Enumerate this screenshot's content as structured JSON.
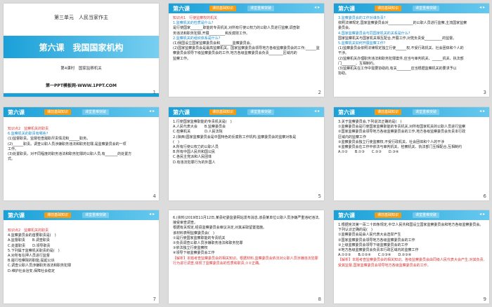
{
  "slides": [
    {
      "number": "1",
      "unit": "第三单元　人民当家作主",
      "title": "第六课　我国国家机构",
      "subtitle": "第4课时　国家监察机关",
      "site": "第一PPT模板网-WWW.1PPT.COM"
    },
    {
      "number": "2",
      "header": "第六课",
      "tab1": "课前基础知识",
      "tab2": "课堂重难突破",
      "lines": [
        "知识点1　行使监察权的机关",
        "1.监察机关的性质是什么?",
        "是行使国家_______职能的专责机关,对所有行使公权力的公职人员进行监察,调查职",
        "务违法和职务犯罪,开展_________和反腐败工作。",
        "2.监察机关的组织体系是什么?",
        "(1)我国设立国家监察委员会和_______监察委员会。",
        "(2)国家监察委员会是最高监察机关。国家监察委员会领导地方各级监察委员会的工作;______监",
        "察委员会领导下级监察委员会的工作,地方各级监察委员会负责________区域内的",
        "监察工作。"
      ]
    },
    {
      "number": "3",
      "lines": [
        "3.监察委员会的工作对谁负责?",
        "依照法律规定,国家监察委员会对______________的公职人员进行监察,主流国家监察",
        "委员会。",
        "4.国家监察委员会与同国家机关的关系是什么?",
        "国家监察机关与国家机关相互配合,开展工作,对党负责受__________的监督。",
        "5.监察机关如何开展监察工作?",
        "(1)监察委员会依照法律规定独立行使______权,不受行政机关、社会团体和个人的",
        "干涉。",
        "(2)监察机关办理职务违法和职务犯罪案件,应当与审判机关、______机关、执法部",
        "门________、互相制约。",
        "(3)监察机关在工作中需要协助的,有关________应当根据监察机关的要求予以",
        "协助。"
      ]
    },
    {
      "number": "4",
      "lines": [
        "知识点2　监察机关的职责",
        "6.监察机关的职责有哪些?",
        "(1)监督职责。监督检查履职尽责情况和______职务。",
        "(2)______职责。调查公职人员涉嫌职务违法和职务犯罪,是监察委员会的一项",
        "工作。",
        "(3)处置职责。对不同程度的职务违法和职务犯罪的公职人员,有_______的处置方",
        "式。"
      ]
    },
    {
      "number": "5",
      "lines": [
        "1.行使国家监察职能的专责机关是(　)",
        "A.人民代表大会　　B.监察委员会",
        "C.检察机关　　　　D.人民法院",
        "2.(陕西)国家监察委员会是中国特色的反腐败工作机构,监察委员会的监察对象是",
        "(　)",
        "A.所有行使公权力的公职人员",
        "B.所有中国人民共和国公民",
        "C.各民主党派和人民团体",
        "D.有违法犯罪行为的外国人"
      ]
    },
    {
      "number": "6",
      "lines": [
        "3.关于监察委员会,下列说法正确的是(　)",
        "①监察委员会是行使国家监察职能的专责机关,对所有国家机关的公职人员进行监察",
        "②国家监察委员会领导地方各级监察委员会的工作,地方各级监察委员会负责本行政",
        "区域内的监察工作",
        "③监察委员会独立行使监察权,不受行政机关、社会团体和个人的干涉",
        "④监察委员会在工作中依法与审判机关、检察机关、执法部门互相配合,互相制约",
        "A.①②　　B.①③　　C.②③　　D.③④"
      ]
    },
    {
      "number": "7",
      "lines": [
        "知识点2　监察机关的职责",
        "4.监察委员会的首要职责是(　)",
        "A.监督职责　　B.调查职责",
        "C.处置职责　　D.领导职责",
        "5.下列属于监察机关职责的是(　)",
        "A.对所有在押人员进行监督",
        "B.履行检察院的职能,提起公诉",
        "C.调查公职人员涉嫌职务违法和职务犯罪",
        "D.维护社会治安,保障社会稳定"
      ]
    },
    {
      "number": "8",
      "lines": [
        "6.(资料)2019年11月12日,某县纪委监委网站发布消息,该县某单位公职人员涉嫌严重违纪违法,接受审查调查。",
        "根据有关规定,经县监察委员会审议决定,对其采取留置措施。",
        "该材料表明监察委员会(　)",
        "①是行使国家监察职能的专责机关",
        "②负责调查公职人员涉嫌职务违法和职务犯罪",
        "③依法独立行使监察权",
        "④领导下级监察委员会工作",
        "【解析】本题考查监察委员会的相关知识。根据材料,监察委员会依法对公职人员涉嫌违法犯罪行为进行调查,体现了监察委员会的性质和职责,①②正确。"
      ]
    },
    {
      "number": "9",
      "lines": [
        "1.根据宪法第一百二十四条规定,中华人民共和国设立国家监察委员会和地方各级监察委员会。下列认识正确的是(　)",
        "①监察委员会是由人民代表大会选举产生",
        "②国家监察委员会领导地方各级监察委员会的工作",
        "③上级监察委员会领导下级监察委员会的工作",
        "④地方各级监察委员会负责本行政区域内的监察工作",
        "A.①②③　　B.①②④　　C.①③④　　D.②③④",
        "【解析】本题考查监察委员会的相关知识。各级监察委员会由同级人民代表大会产生,对其负责,受其监督,国家监察委员会领导地方各级监察委员会的工作。"
      ]
    }
  ],
  "colors": {
    "accent": "#1aa0d8",
    "tab": "#f39c12",
    "selection": "#f5a623"
  }
}
